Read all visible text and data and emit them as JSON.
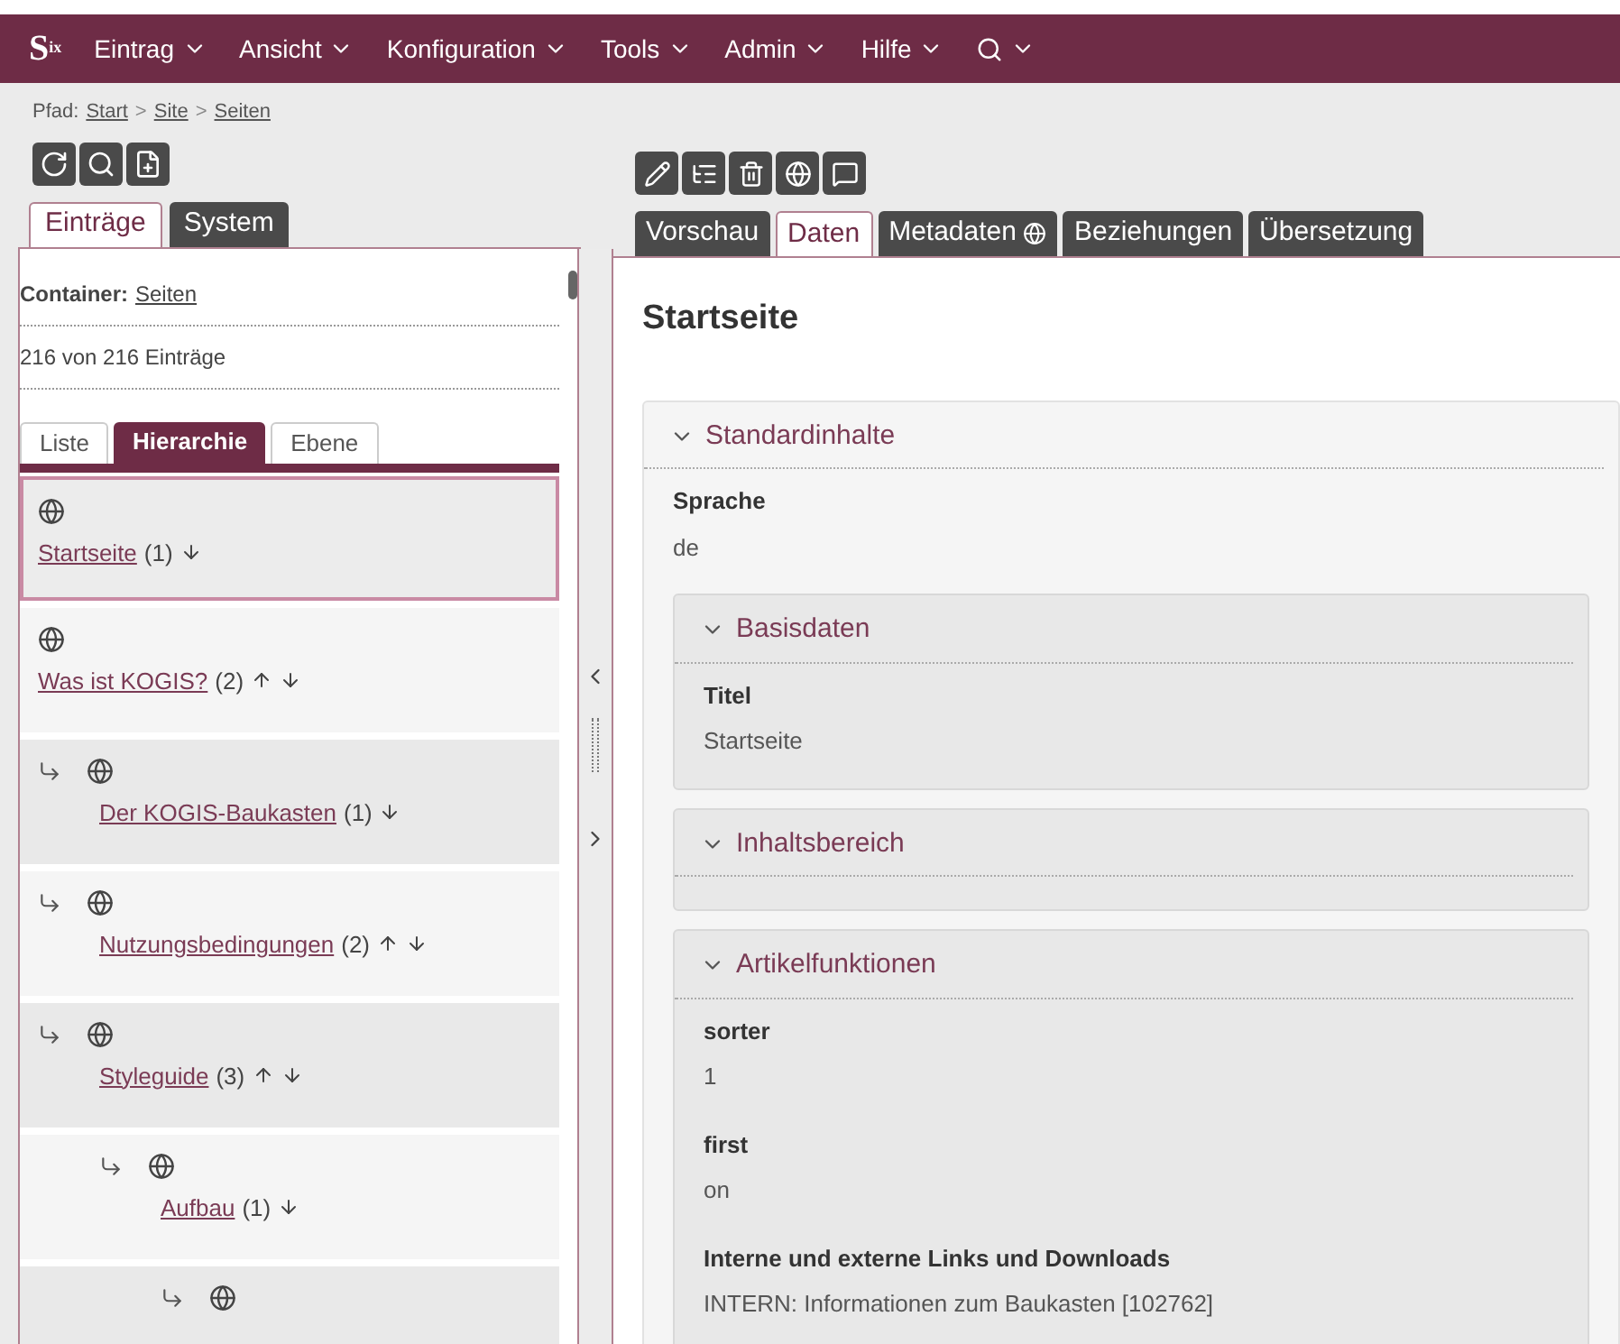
{
  "logo": {
    "letter": "S",
    "sup": "ix"
  },
  "menu": [
    "Eintrag",
    "Ansicht",
    "Konfiguration",
    "Tools",
    "Admin",
    "Hilfe"
  ],
  "breadcrumb": {
    "label": "Pfad:",
    "separator": ">",
    "links": [
      "Start",
      "Site",
      "Seiten"
    ]
  },
  "left_tabs": [
    {
      "label": "Einträge",
      "selected": true
    },
    {
      "label": "System",
      "selected": false
    }
  ],
  "right_tabs": [
    {
      "label": "Vorschau",
      "selected": false,
      "globe": false
    },
    {
      "label": "Daten",
      "selected": true,
      "globe": false
    },
    {
      "label": "Metadaten",
      "selected": false,
      "globe": true
    },
    {
      "label": "Beziehungen",
      "selected": false,
      "globe": false
    },
    {
      "label": "Übersetzung",
      "selected": false,
      "globe": false
    }
  ],
  "container": {
    "label": "Container:",
    "link": "Seiten"
  },
  "count": "216 von 216 Einträge",
  "view_tabs": [
    {
      "label": "Liste",
      "selected": false
    },
    {
      "label": "Hierarchie",
      "selected": true
    },
    {
      "label": "Ebene",
      "selected": false
    }
  ],
  "tree": [
    {
      "label": "Startseite",
      "count": "(1)",
      "up": false,
      "down": true,
      "selected": true
    },
    {
      "label": "Was ist KOGIS?",
      "count": "(2)",
      "up": true,
      "down": true,
      "selected": false,
      "children": [
        {
          "label": "Der KOGIS-Baukasten",
          "count": "(1)",
          "up": false,
          "down": true,
          "selected": false
        },
        {
          "label": "Nutzungsbedingungen",
          "count": "(2)",
          "up": true,
          "down": true,
          "selected": false
        },
        {
          "label": "Styleguide",
          "count": "(3)",
          "up": true,
          "down": true,
          "selected": false,
          "children": [
            {
              "label": "Aufbau",
              "count": "(1)",
              "up": false,
              "down": true,
              "selected": false,
              "children": [
                {
                  "selected": false
                }
              ]
            }
          ]
        }
      ]
    }
  ],
  "page_title": "Startseite",
  "sections": [
    {
      "title": "Standardinhalte",
      "expanded": true,
      "fields": [
        {
          "label": "Sprache",
          "value": "de"
        }
      ],
      "children": [
        {
          "title": "Basisdaten",
          "expanded": true,
          "fields": [
            {
              "label": "Titel",
              "value": "Startseite"
            }
          ]
        },
        {
          "title": "Inhaltsbereich",
          "expanded": true
        },
        {
          "title": "Artikelfunktionen",
          "expanded": true,
          "fields": [
            {
              "label": "sorter",
              "value": "1"
            },
            {
              "label": "first",
              "value": "on"
            },
            {
              "label": "Interne und externe Links und Downloads",
              "value": "INTERN: Informationen zum Baukasten [102762]"
            }
          ]
        }
      ]
    }
  ]
}
